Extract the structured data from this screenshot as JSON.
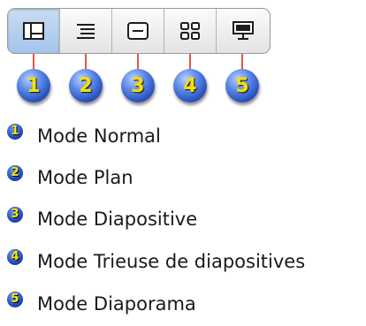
{
  "toolbar": {
    "buttons": [
      {
        "icon": "normal-view-icon",
        "active": true
      },
      {
        "icon": "outline-view-icon",
        "active": false
      },
      {
        "icon": "slide-view-icon",
        "active": false
      },
      {
        "icon": "slide-sorter-view-icon",
        "active": false
      },
      {
        "icon": "slideshow-view-icon",
        "active": false
      }
    ]
  },
  "callouts": {
    "numbers": [
      "1",
      "2",
      "3",
      "4",
      "5"
    ]
  },
  "legend": {
    "items": [
      {
        "number": "1",
        "label": "Mode Normal"
      },
      {
        "number": "2",
        "label": "Mode Plan"
      },
      {
        "number": "3",
        "label": "Mode Diapositive"
      },
      {
        "number": "4",
        "label": "Mode Trieuse de diapositives"
      },
      {
        "number": "5",
        "label": "Mode Diaporama"
      }
    ]
  },
  "colors": {
    "active_segment": "#a3c4ea",
    "connector_line": "#e0584a",
    "badge_blue": "#1f47b4",
    "badge_number": "#f6e000"
  }
}
